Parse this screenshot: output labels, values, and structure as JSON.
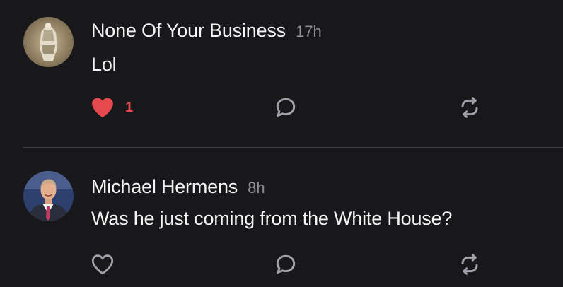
{
  "colors": {
    "background": "#18181b",
    "text_primary": "#f4f4f5",
    "text_muted": "#8e8e93",
    "like_active": "#e5484d",
    "icon_default": "#a1a1aa",
    "divider": "#3f3f46"
  },
  "comments": [
    {
      "author": "None Of Your Business",
      "time": "17h",
      "text": "Lol",
      "liked": true,
      "like_count": "1",
      "icons": [
        "heart-filled-icon",
        "reply-bubble-icon",
        "repost-icon"
      ]
    },
    {
      "author": "Michael Hermens",
      "time": "8h",
      "text": "Was he just coming from the White House?",
      "liked": false,
      "like_count": "",
      "icons": [
        "heart-outline-icon",
        "reply-bubble-icon",
        "repost-icon"
      ]
    }
  ]
}
